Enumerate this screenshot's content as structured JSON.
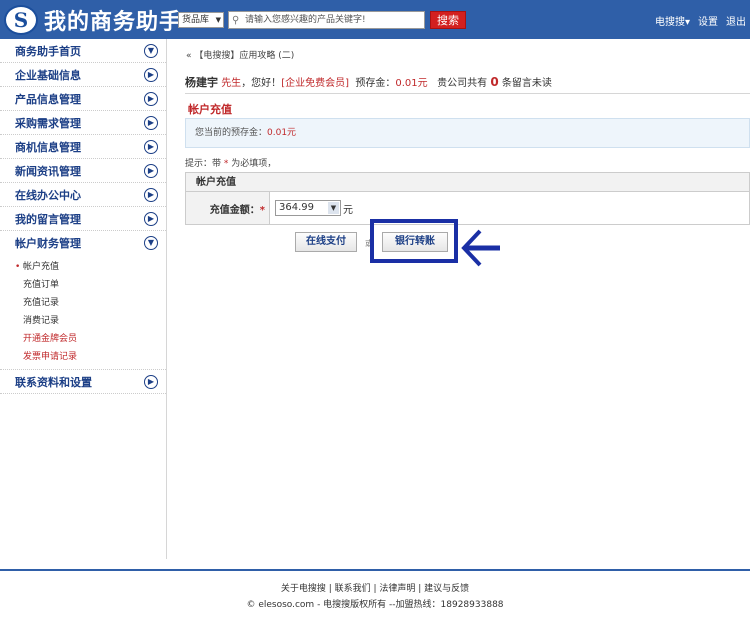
{
  "header": {
    "logo_mark": "S",
    "logo_text": "我的商务助手",
    "search_type": "货品库",
    "search_placeholder": "请输入您感兴趣的产品关键字!",
    "search_button": "搜索",
    "user_menu": "电搜搜",
    "settings": "设置",
    "exit": "退出"
  },
  "sidebar": {
    "items": [
      {
        "label": "商务助手首页",
        "icon": "chevron-down-icon"
      },
      {
        "label": "企业基础信息",
        "icon": "chevron-right-icon"
      },
      {
        "label": "产品信息管理",
        "icon": "chevron-right-icon"
      },
      {
        "label": "采购需求管理",
        "icon": "chevron-right-icon"
      },
      {
        "label": "商机信息管理",
        "icon": "chevron-right-icon"
      },
      {
        "label": "新闻资讯管理",
        "icon": "chevron-right-icon"
      },
      {
        "label": "在线办公中心",
        "icon": "chevron-right-icon"
      },
      {
        "label": "我的留言管理",
        "icon": "chevron-right-icon"
      },
      {
        "label": "帐户财务管理",
        "icon": "chevron-down-icon"
      }
    ],
    "sub_items": [
      "帐户充值",
      "充值订单",
      "充值记录",
      "消费记录",
      "开通金牌会员",
      "发票申请记录"
    ],
    "last_item": {
      "label": "联系资料和设置",
      "icon": "chevron-right-icon"
    }
  },
  "main": {
    "breadcrumb": "【电搜搜】应用攻略 (二)",
    "user_name": "杨建宇",
    "salutation": "先生",
    "greeting": "，您好！",
    "member_level": "[企业免费会员]",
    "deposit_label": "预存金：",
    "deposit_value": "0.01元",
    "company_msg_prefix": "贵公司共有",
    "unread_count": "0",
    "company_msg_suffix": "条留言未读",
    "section_title": "帐户充值",
    "balance_text": "您当前的预存金：",
    "balance_value": "0.01元",
    "tip_prefix": "提示：带",
    "tip_star": "*",
    "tip_suffix": "为必填项，",
    "form_header": "帐户充值",
    "amount_label": "充值金额：",
    "amount_star": "*",
    "amount_value": "364.99",
    "amount_unit": "元",
    "btn_online": "在线支付",
    "btn_sep": "或",
    "btn_bank": "银行转账"
  },
  "footer": {
    "links": [
      "关于电搜搜",
      "联系我们",
      "法律声明",
      "建议与反馈"
    ],
    "copyright": "© elesoso.com - 电搜搜版权所有 --加盟热线：18928933888"
  },
  "colors": {
    "header_blue": "#2f5fa8",
    "accent_red": "#c0292b",
    "highlight_blue": "#1a2fa5"
  }
}
